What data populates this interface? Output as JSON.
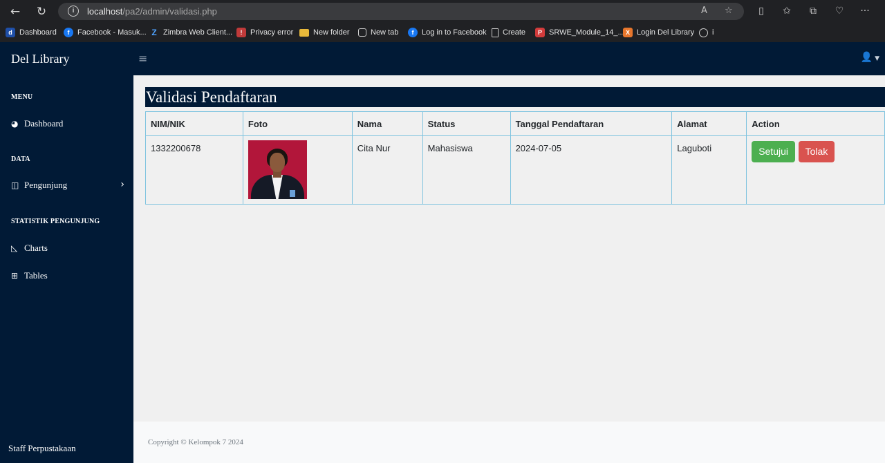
{
  "browser": {
    "url_host": "localhost",
    "url_path": "/pa2/admin/validasi.php",
    "bookmarks": [
      {
        "label": "Dashboard",
        "icon": "del-icon"
      },
      {
        "label": "Facebook - Masuk...",
        "icon": "facebook-icon"
      },
      {
        "label": "Zimbra Web Client...",
        "icon": "zimbra-icon"
      },
      {
        "label": "Privacy error",
        "icon": "warning-icon"
      },
      {
        "label": "New folder",
        "icon": "folder-icon"
      },
      {
        "label": "New tab",
        "icon": "tab-icon"
      },
      {
        "label": "Log in to Facebook",
        "icon": "facebook-icon"
      },
      {
        "label": "Create",
        "icon": "document-icon"
      },
      {
        "label": "SRWE_Module_14_...",
        "icon": "pdf-icon"
      },
      {
        "label": "Login Del Library",
        "icon": "xampp-icon"
      },
      {
        "label": "i",
        "icon": "info-icon"
      }
    ]
  },
  "sidebar": {
    "brand": "Del Library",
    "sections": [
      {
        "heading": "MENU"
      },
      {
        "heading": "DATA"
      },
      {
        "heading": "STATISTIK PENGUNJUNG"
      }
    ],
    "items": [
      {
        "label": "Dashboard",
        "icon": "dashboard-icon"
      },
      {
        "label": "Pengunjung",
        "icon": "columns-icon"
      },
      {
        "label": "Charts",
        "icon": "area-chart-icon"
      },
      {
        "label": "Tables",
        "icon": "table-icon"
      }
    ],
    "footer": "Staff Perpustakaan"
  },
  "main": {
    "title": "Validasi Pendaftaran",
    "columns": [
      "NIM/NIK",
      "Foto",
      "Nama",
      "Status",
      "Tanggal Pendaftaran",
      "Alamat",
      "Action"
    ],
    "rows": [
      {
        "nim": "1332200678",
        "nama": "Cita Nur",
        "status": "Mahasiswa",
        "tanggal": "2024-07-05",
        "alamat": "Laguboti",
        "approve_label": "Setujui",
        "reject_label": "Tolak"
      }
    ]
  },
  "footer": {
    "copyright": "Copyright © Kelompok 7 2024"
  },
  "colors": {
    "sidebar_bg": "#011a36",
    "approve": "#4caf50",
    "reject": "#d9534f",
    "table_border": "#7ec3df"
  }
}
